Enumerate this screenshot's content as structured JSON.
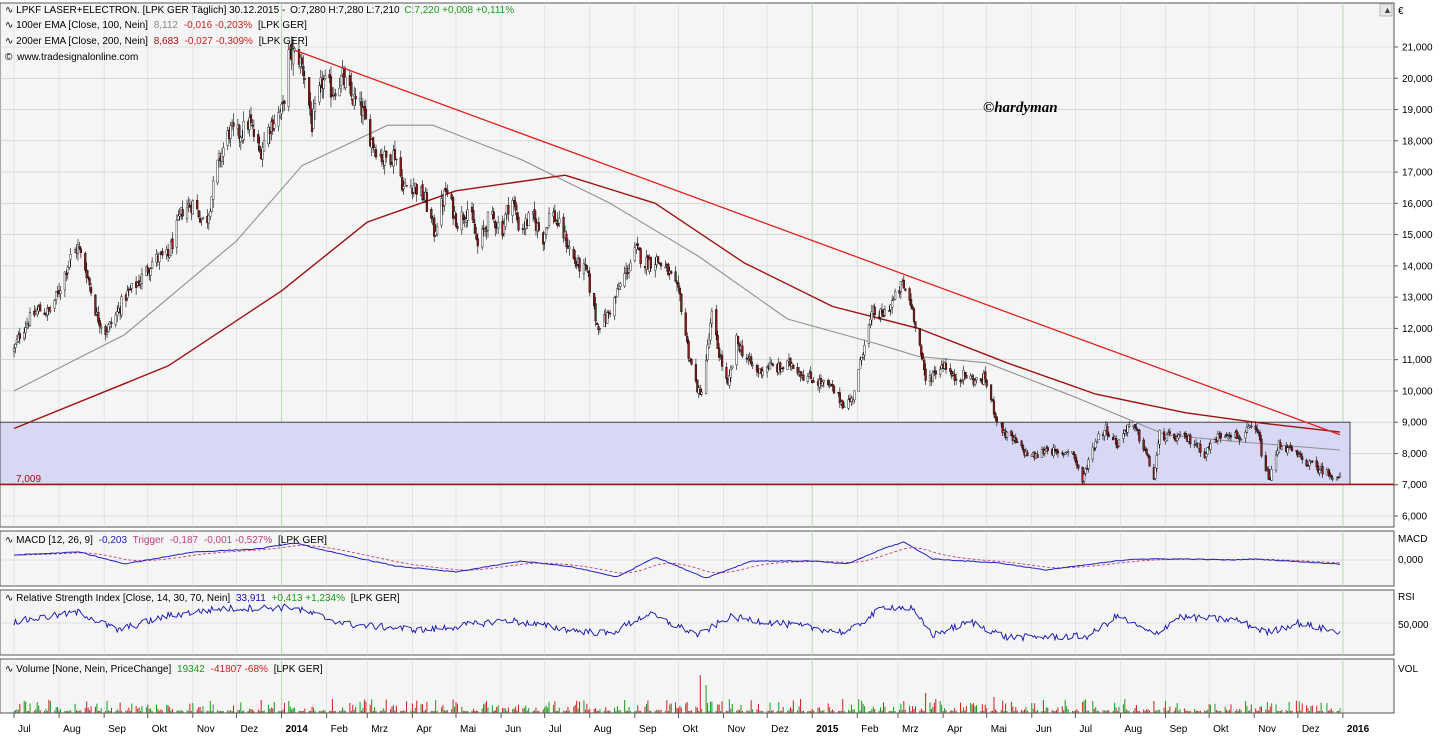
{
  "header": {
    "main_title": "LPKF LASER+ELECTRON. [LPK GER  Täglich] 30.12.2015 -",
    "ohlc": "O:7,280 H:7,280 L:7,210",
    "close_change": "C:7,220 +0,008 +0,111%",
    "ema100_label": "100er EMA [Close, 100, Nein]",
    "ema100_value": "8,112",
    "ema100_change": "-0,016 -0,203%",
    "ema100_suffix": "[LPK GER]",
    "ema200_label": "200er EMA [Close, 200, Nein]",
    "ema200_value": "8,683",
    "ema200_change": "-0,027 -0,309%",
    "ema200_suffix": "[LPK GER]",
    "source": "www.tradesignalonline.com"
  },
  "watermark": "©hardyman",
  "currency": "€",
  "support_label": "7,009",
  "panels": {
    "macd": {
      "label": "MACD [12, 26, 9]",
      "value": "-0,203",
      "trigger_label": "Trigger",
      "trigger_value": "-0,187",
      "change": "-0,001 -0,527%",
      "suffix": "[LPK GER]",
      "axis_title": "MACD",
      "tick": "0,000"
    },
    "rsi": {
      "label": "Relative Strength Index [Close, 14, 30, 70, Nein]",
      "value": "33,911",
      "change": "+0,413 +1,234%",
      "suffix": "[LPK GER]",
      "axis_title": "RSI",
      "tick": "50,000"
    },
    "volume": {
      "label": "Volume [None, Nein, PriceChange]",
      "value": "19342",
      "change": "-41807 -68%",
      "suffix": "[LPK GER]",
      "axis_title": "VOL"
    }
  },
  "colors": {
    "up_candle": "#ffffff",
    "down_candle": "#8b1a1a",
    "ema100": "#909090",
    "ema200": "#a01010",
    "trendline": "#e02020",
    "macd_line": "#2020c0",
    "trigger_line": "#c04080",
    "rsi_line": "#1010b0",
    "support_zone": "#d8d8f4",
    "vol_up": "#1a9a1a",
    "vol_down": "#cc2020"
  },
  "chart_data": {
    "type": "candlestick",
    "ylim": [
      5.6,
      21.6
    ],
    "y_ticks": [
      "6,000",
      "7,000",
      "8,000",
      "9,000",
      "10,000",
      "11,000",
      "12,000",
      "13,000",
      "14,000",
      "15,000",
      "16,000",
      "17,000",
      "18,000",
      "19,000",
      "20,000",
      "21,000"
    ],
    "x_labels": [
      "Jul",
      "Aug",
      "Sep",
      "Okt",
      "Nov",
      "Dez",
      "2014",
      "Feb",
      "Mrz",
      "Apr",
      "Mai",
      "Jun",
      "Jul",
      "Aug",
      "Sep",
      "Okt",
      "Nov",
      "Dez",
      "2015",
      "Feb",
      "Mrz",
      "Apr",
      "Mai",
      "Jun",
      "Jul",
      "Aug",
      "Sep",
      "Okt",
      "Nov",
      "Dez",
      "2016"
    ],
    "close_path": [
      [
        "2013-07-01",
        11.3
      ],
      [
        "2013-07-05",
        11.8
      ],
      [
        "2013-07-10",
        12.2
      ],
      [
        "2013-07-18",
        12.6
      ],
      [
        "2013-07-25",
        12.5
      ],
      [
        "2013-08-01",
        13.2
      ],
      [
        "2013-08-08",
        14.2
      ],
      [
        "2013-08-14",
        14.6
      ],
      [
        "2013-08-20",
        13.8
      ],
      [
        "2013-08-27",
        12.4
      ],
      [
        "2013-09-02",
        11.9
      ],
      [
        "2013-09-08",
        12.3
      ],
      [
        "2013-09-15",
        13.0
      ],
      [
        "2013-09-25",
        13.5
      ],
      [
        "2013-10-05",
        14.2
      ],
      [
        "2013-10-15",
        14.3
      ],
      [
        "2013-10-25",
        15.8
      ],
      [
        "2013-11-01",
        16.0
      ],
      [
        "2013-11-10",
        15.3
      ],
      [
        "2013-11-18",
        17.2
      ],
      [
        "2013-11-26",
        18.3
      ],
      [
        "2013-12-03",
        18.2
      ],
      [
        "2013-12-10",
        18.6
      ],
      [
        "2013-12-17",
        17.6
      ],
      [
        "2013-12-24",
        18.5
      ],
      [
        "2014-01-02",
        19.0
      ],
      [
        "2014-01-06",
        20.7
      ],
      [
        "2014-01-12",
        20.8
      ],
      [
        "2014-01-17",
        20.1
      ],
      [
        "2014-01-22",
        18.5
      ],
      [
        "2014-01-29",
        19.9
      ],
      [
        "2014-02-05",
        19.6
      ],
      [
        "2014-02-12",
        20.0
      ],
      [
        "2014-02-18",
        19.4
      ],
      [
        "2014-02-25",
        19.0
      ],
      [
        "2014-03-04",
        18.0
      ],
      [
        "2014-03-12",
        17.4
      ],
      [
        "2014-03-20",
        17.6
      ],
      [
        "2014-03-26",
        16.5
      ],
      [
        "2014-04-02",
        16.6
      ],
      [
        "2014-04-10",
        16.1
      ],
      [
        "2014-04-16",
        15.1
      ],
      [
        "2014-04-24",
        16.4
      ],
      [
        "2014-05-02",
        15.4
      ],
      [
        "2014-05-10",
        15.9
      ],
      [
        "2014-05-16",
        14.6
      ],
      [
        "2014-05-24",
        15.6
      ],
      [
        "2014-06-02",
        15.2
      ],
      [
        "2014-06-08",
        16.3
      ],
      [
        "2014-06-14",
        15.1
      ],
      [
        "2014-06-22",
        15.6
      ],
      [
        "2014-06-30",
        14.9
      ],
      [
        "2014-07-05",
        15.8
      ],
      [
        "2014-07-14",
        15.0
      ],
      [
        "2014-07-22",
        14.1
      ],
      [
        "2014-07-30",
        13.8
      ],
      [
        "2014-08-06",
        12.1
      ],
      [
        "2014-08-12",
        12.3
      ],
      [
        "2014-08-18",
        12.9
      ],
      [
        "2014-08-24",
        13.6
      ],
      [
        "2014-09-02",
        14.5
      ],
      [
        "2014-09-08",
        14.1
      ],
      [
        "2014-09-16",
        14.2
      ],
      [
        "2014-09-24",
        13.8
      ],
      [
        "2014-10-02",
        13.0
      ],
      [
        "2014-10-08",
        11.2
      ],
      [
        "2014-10-12",
        10.4
      ],
      [
        "2014-10-16",
        9.8
      ],
      [
        "2014-10-20",
        11.0
      ],
      [
        "2014-10-24",
        12.4
      ],
      [
        "2014-10-28",
        11.4
      ],
      [
        "2014-11-04",
        10.1
      ],
      [
        "2014-11-10",
        11.6
      ],
      [
        "2014-11-16",
        11.1
      ],
      [
        "2014-11-24",
        10.6
      ],
      [
        "2014-12-02",
        10.8
      ],
      [
        "2014-12-10",
        10.7
      ],
      [
        "2014-12-18",
        10.9
      ],
      [
        "2014-12-26",
        10.5
      ],
      [
        "2015-01-05",
        10.3
      ],
      [
        "2015-01-14",
        10.1
      ],
      [
        "2015-01-22",
        9.6
      ],
      [
        "2015-01-28",
        9.7
      ],
      [
        "2015-02-02",
        10.6
      ],
      [
        "2015-02-06",
        11.6
      ],
      [
        "2015-02-12",
        12.5
      ],
      [
        "2015-02-18",
        12.4
      ],
      [
        "2015-02-26",
        12.9
      ],
      [
        "2015-03-04",
        13.4
      ],
      [
        "2015-03-10",
        12.8
      ],
      [
        "2015-03-14",
        12.0
      ],
      [
        "2015-03-20",
        10.3
      ],
      [
        "2015-03-26",
        10.6
      ],
      [
        "2015-04-02",
        10.9
      ],
      [
        "2015-04-08",
        10.4
      ],
      [
        "2015-04-16",
        10.5
      ],
      [
        "2015-04-24",
        10.3
      ],
      [
        "2015-04-30",
        10.4
      ],
      [
        "2015-05-04",
        9.7
      ],
      [
        "2015-05-08",
        9.1
      ],
      [
        "2015-05-14",
        8.6
      ],
      [
        "2015-05-20",
        8.4
      ],
      [
        "2015-05-28",
        8.0
      ],
      [
        "2015-06-04",
        7.9
      ],
      [
        "2015-06-12",
        8.2
      ],
      [
        "2015-06-20",
        7.9
      ],
      [
        "2015-06-28",
        8.2
      ],
      [
        "2015-07-06",
        7.1
      ],
      [
        "2015-07-10",
        7.8
      ],
      [
        "2015-07-16",
        8.5
      ],
      [
        "2015-07-22",
        8.8
      ],
      [
        "2015-07-30",
        8.3
      ],
      [
        "2015-08-06",
        8.9
      ],
      [
        "2015-08-12",
        8.7
      ],
      [
        "2015-08-18",
        8.1
      ],
      [
        "2015-08-24",
        7.2
      ],
      [
        "2015-08-28",
        8.6
      ],
      [
        "2015-09-04",
        8.5
      ],
      [
        "2015-09-12",
        8.5
      ],
      [
        "2015-09-20",
        8.4
      ],
      [
        "2015-09-28",
        8.0
      ],
      [
        "2015-10-06",
        8.5
      ],
      [
        "2015-10-14",
        8.7
      ],
      [
        "2015-10-22",
        8.5
      ],
      [
        "2015-10-30",
        8.8
      ],
      [
        "2015-11-04",
        8.6
      ],
      [
        "2015-11-08",
        7.5
      ],
      [
        "2015-11-12",
        7.2
      ],
      [
        "2015-11-18",
        8.3
      ],
      [
        "2015-11-26",
        8.1
      ],
      [
        "2015-12-04",
        7.8
      ],
      [
        "2015-12-12",
        7.6
      ],
      [
        "2015-12-20",
        7.4
      ],
      [
        "2015-12-30",
        7.22
      ]
    ],
    "ema100_path": [
      [
        "2013-07-01",
        10.0
      ],
      [
        "2013-09-15",
        11.8
      ],
      [
        "2013-12-01",
        14.8
      ],
      [
        "2014-01-15",
        17.2
      ],
      [
        "2014-03-15",
        18.5
      ],
      [
        "2014-04-15",
        18.5
      ],
      [
        "2014-06-15",
        17.4
      ],
      [
        "2014-08-15",
        16.0
      ],
      [
        "2014-10-15",
        14.3
      ],
      [
        "2014-12-15",
        12.3
      ],
      [
        "2015-02-15",
        11.5
      ],
      [
        "2015-03-15",
        11.1
      ],
      [
        "2015-05-01",
        10.9
      ],
      [
        "2015-07-01",
        9.8
      ],
      [
        "2015-09-01",
        8.6
      ],
      [
        "2015-10-15",
        8.4
      ],
      [
        "2015-12-30",
        8.112
      ]
    ],
    "ema200_path": [
      [
        "2013-07-01",
        8.8
      ],
      [
        "2013-10-15",
        10.8
      ],
      [
        "2014-01-01",
        13.2
      ],
      [
        "2014-03-01",
        15.4
      ],
      [
        "2014-05-01",
        16.4
      ],
      [
        "2014-07-15",
        16.9
      ],
      [
        "2014-09-15",
        16.0
      ],
      [
        "2014-11-15",
        14.1
      ],
      [
        "2015-01-15",
        12.7
      ],
      [
        "2015-03-15",
        12.0
      ],
      [
        "2015-05-15",
        10.9
      ],
      [
        "2015-07-15",
        9.9
      ],
      [
        "2015-09-15",
        9.3
      ],
      [
        "2015-11-01",
        9.0
      ],
      [
        "2015-12-30",
        8.683
      ]
    ],
    "trendline": [
      [
        "2014-01-10",
        20.9
      ],
      [
        "2015-12-30",
        8.6
      ]
    ],
    "support_zone": [
      7.009,
      9.0
    ],
    "support_level": 7.009,
    "macd_path": [
      [
        "2013-07-01",
        0.25
      ],
      [
        "2013-08-15",
        0.4
      ],
      [
        "2013-09-15",
        -0.2
      ],
      [
        "2013-11-01",
        0.4
      ],
      [
        "2013-12-15",
        0.55
      ],
      [
        "2014-01-10",
        0.85
      ],
      [
        "2014-02-10",
        0.3
      ],
      [
        "2014-03-20",
        -0.3
      ],
      [
        "2014-05-01",
        -0.6
      ],
      [
        "2014-06-15",
        -0.05
      ],
      [
        "2014-07-20",
        -0.35
      ],
      [
        "2014-08-20",
        -0.85
      ],
      [
        "2014-09-15",
        0.15
      ],
      [
        "2014-10-20",
        -0.9
      ],
      [
        "2014-11-20",
        -0.05
      ],
      [
        "2015-01-01",
        -0.05
      ],
      [
        "2015-01-25",
        -0.2
      ],
      [
        "2015-02-20",
        0.6
      ],
      [
        "2015-03-05",
        0.9
      ],
      [
        "2015-03-25",
        0.05
      ],
      [
        "2015-05-10",
        -0.15
      ],
      [
        "2015-06-10",
        -0.5
      ],
      [
        "2015-08-10",
        0.05
      ],
      [
        "2015-09-15",
        0.05
      ],
      [
        "2015-10-15",
        0.0
      ],
      [
        "2015-11-01",
        0.05
      ],
      [
        "2015-12-30",
        -0.203
      ]
    ],
    "rsi_path": [
      [
        "2013-07-01",
        52
      ],
      [
        "2013-08-15",
        68
      ],
      [
        "2013-09-10",
        38
      ],
      [
        "2013-10-15",
        62
      ],
      [
        "2013-11-20",
        74
      ],
      [
        "2014-01-08",
        76
      ],
      [
        "2014-02-15",
        48
      ],
      [
        "2014-04-10",
        38
      ],
      [
        "2014-06-05",
        55
      ],
      [
        "2014-07-20",
        38
      ],
      [
        "2014-08-15",
        32
      ],
      [
        "2014-09-10",
        65
      ],
      [
        "2014-10-15",
        30
      ],
      [
        "2014-11-05",
        60
      ],
      [
        "2014-12-20",
        46
      ],
      [
        "2015-01-25",
        34
      ],
      [
        "2015-02-20",
        78
      ],
      [
        "2015-03-10",
        74
      ],
      [
        "2015-03-25",
        30
      ],
      [
        "2015-04-20",
        52
      ],
      [
        "2015-05-15",
        26
      ],
      [
        "2015-07-10",
        28
      ],
      [
        "2015-07-30",
        62
      ],
      [
        "2015-08-24",
        30
      ],
      [
        "2015-09-10",
        60
      ],
      [
        "2015-10-20",
        55
      ],
      [
        "2015-11-10",
        34
      ],
      [
        "2015-12-01",
        50
      ],
      [
        "2015-12-30",
        33.911
      ]
    ]
  }
}
